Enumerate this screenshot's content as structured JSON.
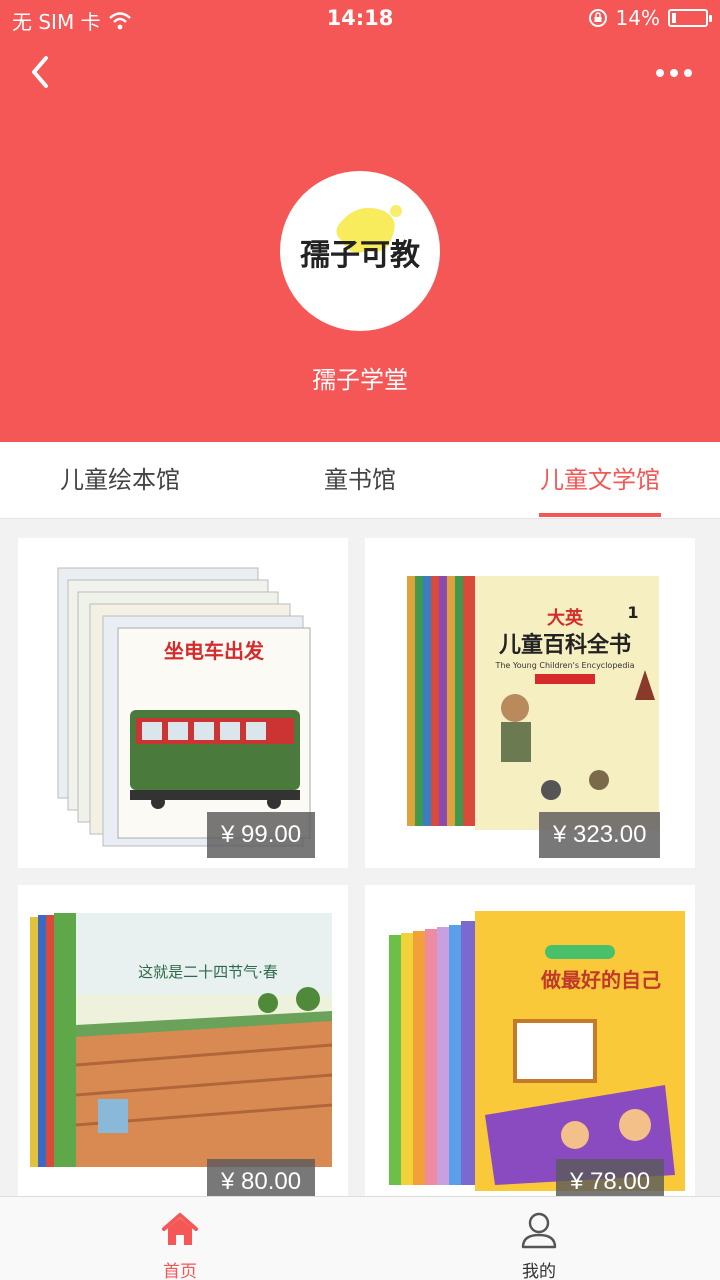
{
  "status_bar": {
    "carrier": "无 SIM 卡",
    "time": "14:18",
    "battery": "14%",
    "battery_level": 0.14
  },
  "header": {
    "shop_name": "孺子学堂",
    "logo_text": "孺子可教",
    "background_color": "#f55757"
  },
  "tabs": [
    {
      "label": "儿童绘本馆",
      "active": false
    },
    {
      "label": "童书馆",
      "active": false
    },
    {
      "label": "儿童文学馆",
      "active": true
    }
  ],
  "products": [
    {
      "title": "坐电车出发",
      "price": "¥ 99.00"
    },
    {
      "title": "儿童百科全书",
      "subtitle": "大英",
      "english": "The Young Children's Encyclopedia",
      "volume": "1",
      "price": "¥ 323.00"
    },
    {
      "title": "这就是二十四节气·春",
      "price": "¥ 80.00"
    },
    {
      "title": "做最好的自己",
      "price": "¥ 78.00"
    }
  ],
  "bottom_nav": [
    {
      "label": "首页",
      "icon": "home-icon",
      "active": true
    },
    {
      "label": "我的",
      "icon": "user-icon",
      "active": false
    }
  ],
  "colors": {
    "accent": "#f55757",
    "text": "#444444",
    "inactive_icon": "#555555"
  }
}
